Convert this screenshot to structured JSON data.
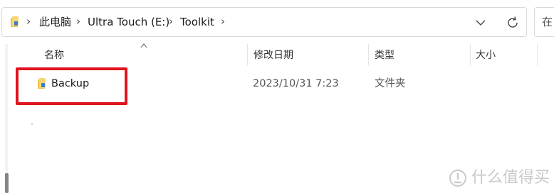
{
  "breadcrumb": {
    "items": [
      "此电脑",
      "Ultra Touch (E:)",
      "Toolkit"
    ]
  },
  "search": {
    "placeholder": "在"
  },
  "columns": {
    "name": "名称",
    "modified": "修改日期",
    "type": "类型",
    "size": "大小"
  },
  "rows": [
    {
      "name": "Backup",
      "modified": "2023/10/31 7:23",
      "type": "文件夹",
      "size": ""
    }
  ],
  "highlight_color": "#e0141e",
  "watermark": {
    "text": "什么值得买"
  }
}
